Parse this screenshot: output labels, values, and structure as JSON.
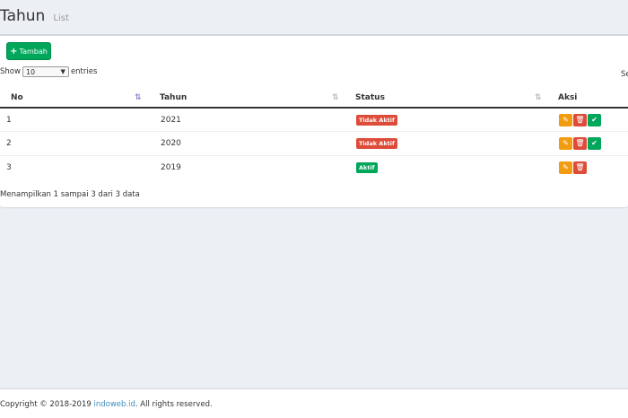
{
  "header": {
    "title": "Tahun",
    "subtitle": "List"
  },
  "toolbar": {
    "add_label": "Tambah"
  },
  "length": {
    "prefix": "Show",
    "value": "10",
    "suffix": "entries"
  },
  "search": {
    "label": "Se"
  },
  "table": {
    "columns": [
      "No",
      "Tahun",
      "Status",
      "Aksi"
    ],
    "rows": [
      {
        "no": "1",
        "tahun": "2021",
        "status": "Tidak Aktif"
      },
      {
        "no": "2",
        "tahun": "2020",
        "status": "Tidak Aktif"
      },
      {
        "no": "3",
        "tahun": "2019",
        "status": "Aktif"
      }
    ]
  },
  "info": "Menampilkan 1 sampai 3 dari 3 data",
  "footer": {
    "prefix": "Copyright © 2018-2019 ",
    "link": "indoweb.id",
    "suffix": ". All rights reserved."
  },
  "colors": {
    "success": "#00a65a",
    "danger": "#dd4b39",
    "warning": "#f39c12"
  },
  "icons": {
    "add": "plus-icon",
    "edit": "edit-icon",
    "delete": "trash-icon",
    "activate": "check-icon"
  }
}
